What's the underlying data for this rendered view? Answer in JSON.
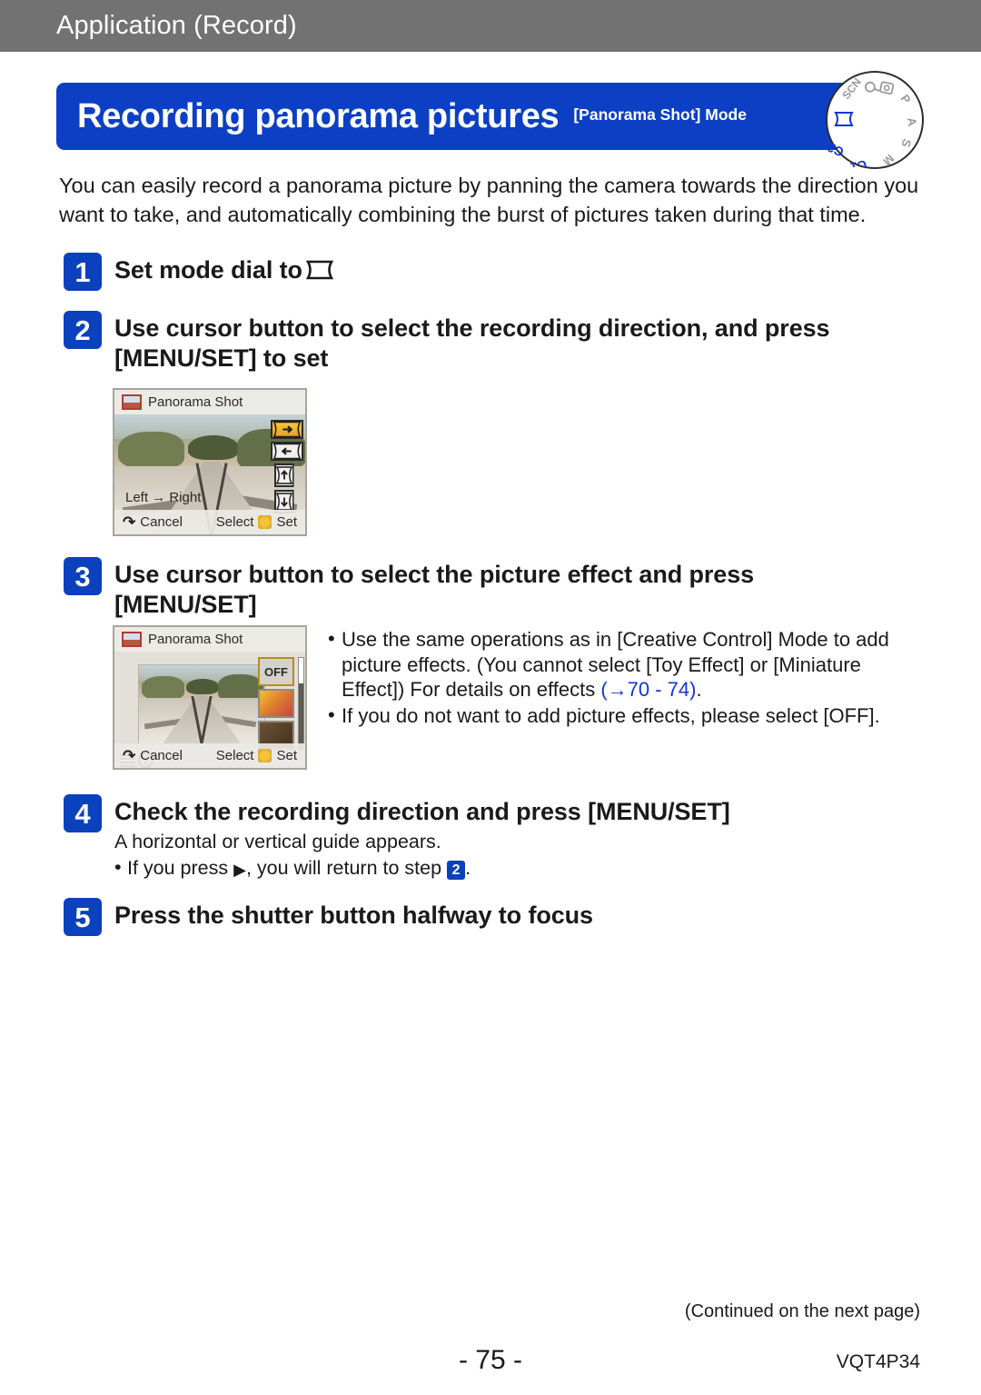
{
  "header": {
    "section_title": "Application (Record)",
    "bar_color": "#727272"
  },
  "title_band": {
    "main": "Recording panorama pictures",
    "sub": "[Panorama Shot] Mode",
    "color": "#0c3fc4"
  },
  "mode_dial": {
    "items": [
      "SCN",
      "☉",
      "▤",
      "P",
      "A",
      "S",
      "M",
      "C1",
      "C2",
      "panorama"
    ],
    "active": "panorama",
    "active_color": "#1335d8"
  },
  "intro": "You can easily record a panorama picture by panning the camera towards the direction you want to take, and automatically combining the burst of pictures taken during that time.",
  "steps": [
    {
      "number": "1",
      "title": "Set mode dial to",
      "has_pano_glyph": true
    },
    {
      "number": "2",
      "title": "Use cursor button to select the recording direction, and press [MENU/SET] to set"
    },
    {
      "number": "3",
      "title": "Use cursor button to select the picture effect and press [MENU/SET]"
    },
    {
      "number": "4",
      "title": "Check the recording direction and press [MENU/SET]"
    },
    {
      "number": "5",
      "title": "Press the shutter button halfway to focus"
    }
  ],
  "lcd_direction": {
    "title": "Panorama Shot",
    "direction_label": "Left → Right",
    "cancel_label": "Cancel",
    "select_label": "Select",
    "set_label": "Set",
    "direction_icons": [
      "right",
      "left",
      "up",
      "down"
    ],
    "selected_direction": "right",
    "selected_color": "#e5a01c"
  },
  "lcd_effect": {
    "title": "Panorama Shot",
    "cancel_label": "Cancel",
    "select_label": "Select",
    "set_label": "Set",
    "effects": [
      "OFF",
      "food",
      "sepia"
    ],
    "selected_effect": "OFF"
  },
  "bullets": [
    {
      "text_before": "Use the same operations as in [Creative Control] Mode to add picture effects. (You cannot select [Toy Effect] or [Miniature Effect]) For details on effects ",
      "link": "(→70 - 74)",
      "text_after": ".",
      "link_color": "#1335d8"
    },
    {
      "text_before": "If you do not want to add picture effects, please select [OFF].",
      "link": "",
      "text_after": ""
    }
  ],
  "step4_body": {
    "line1": "A horizontal or vertical guide appears.",
    "sub_before": "If you press",
    "sub_mid": ", you will return to step",
    "sub_badge": "2",
    "sub_after": "."
  },
  "footer": {
    "continued": "(Continued on the next page)",
    "page_number": "- 75 -",
    "doc_code": "VQT4P34"
  }
}
